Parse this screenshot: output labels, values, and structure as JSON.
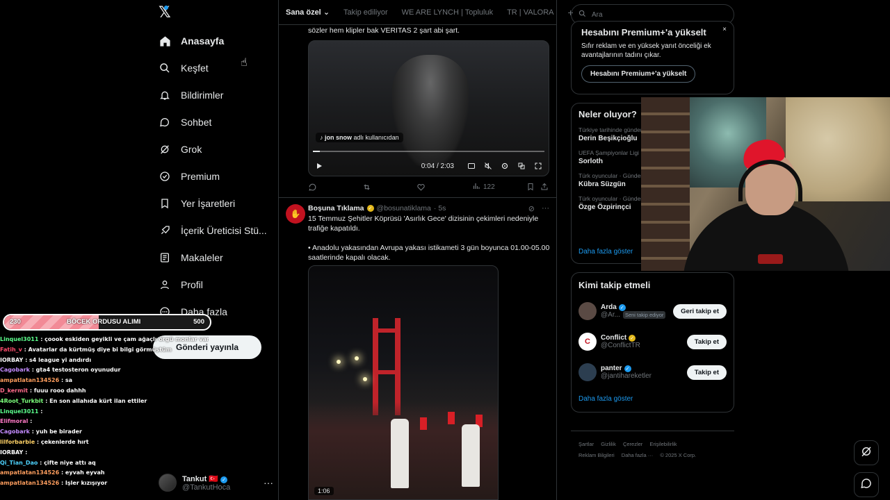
{
  "nav": {
    "items": [
      {
        "label": "Anasayfa",
        "icon": "home-icon"
      },
      {
        "label": "Keşfet",
        "icon": "search-icon"
      },
      {
        "label": "Bildirimler",
        "icon": "bell-icon"
      },
      {
        "label": "Sohbet",
        "icon": "chat-icon"
      },
      {
        "label": "Grok",
        "icon": "grok-icon"
      },
      {
        "label": "Premium",
        "icon": "premium-icon"
      },
      {
        "label": "Yer İşaretleri",
        "icon": "bookmark-icon"
      },
      {
        "label": "İçerik Üreticisi Stü...",
        "icon": "rocket-icon"
      },
      {
        "label": "Makaleler",
        "icon": "article-icon"
      },
      {
        "label": "Profil",
        "icon": "person-icon"
      },
      {
        "label": "Daha fazla",
        "icon": "more-circle-icon"
      }
    ],
    "post_button": "Gönderi yayınla",
    "profile": {
      "name": "Tankut",
      "handle": "@TankutHoca"
    }
  },
  "tabs": [
    "Sana özel",
    "Takip ediliyor",
    "WE ARE LYNCH | Topluluk",
    "TR | VALORA",
    "+"
  ],
  "post1": {
    "text_tail": "sözler hem klipler bak VERITAS 2 şart abi şart.",
    "video_tag_user": "jon snow",
    "video_tag_suffix": "adlı kullanıcıdan",
    "video_time": "0:04 / 2:03",
    "video_progress": 0.03,
    "views": "122"
  },
  "post2": {
    "author": "Boşuna Tıklama",
    "handle": "@bosunatiklama",
    "time": "· 5s",
    "text1": "15 Temmuz Şehitler Köprüsü 'Asırlık Gece' dizisinin çekimleri nedeniyle trafiğe kapatıldı.",
    "text2": "• Anadolu yakasından Avrupa yakası istikameti 3 gün boyunca 01.00-05.00 saatlerinde kapalı olacak.",
    "video_duration": "1:06"
  },
  "search": {
    "placeholder": "Ara"
  },
  "premium": {
    "title": "Hesabını Premium+'a yükselt",
    "desc": "Sıfır reklam ve en yüksek yanıt önceliği ek avantajlarının tadını çıkar.",
    "button": "Hesabını Premium+'a yükselt",
    "close": "×"
  },
  "trends": {
    "title": "Neler oluyor?",
    "items": [
      {
        "context": "Türkiye tarihinde gündem",
        "name": "Derin Beşikçioğlu"
      },
      {
        "context": "UEFA Şampiyonlar Ligi",
        "name": "Sorloth"
      },
      {
        "context": "Türk oyuncular · Gündemde",
        "name": "Kübra Süzgün"
      },
      {
        "context": "Türk oyuncular · Gündemde",
        "name": "Özge Özpirinçci"
      }
    ],
    "more": "Daha fazla göster"
  },
  "who_to_follow": {
    "title": "Kimi takip etmeli",
    "items": [
      {
        "name": "Arda",
        "handle": "@Ar...",
        "badge": "Seni takip ediyor",
        "button": "Geri takip et",
        "verified_color": "#1d9bf0"
      },
      {
        "name": "Conflict",
        "handle": "@ConflictTR",
        "badge": "",
        "button": "Takip et",
        "verified_color": "#e2b719"
      },
      {
        "name": "panter",
        "handle": "@jantihareketler",
        "badge": "",
        "button": "Takip et",
        "verified_color": "#1d9bf0"
      }
    ],
    "more": "Daha fazla göster"
  },
  "footer": {
    "line1": [
      "Şartlar",
      "Gizlilik",
      "Çerezler",
      "Erişilebilirlik"
    ],
    "line2": [
      "Reklam Bilgileri",
      "Daha fazla ···",
      "© 2025 X Corp."
    ]
  },
  "goal": {
    "current": "230",
    "label": "BÖCEK ORDUSU ALIMI",
    "max": "500",
    "progress": 0.46
  },
  "chat": [
    {
      "user": "Linquel3011",
      "color": "#5cff8d",
      "text": ": çoook eskiden geyikli ve çam ağaçlı örgü monlar vardı onlar gibi"
    },
    {
      "user": "Fatih_v",
      "color": "#ff4d6d",
      "text": ": Avatarlar da kürtmüş diye bi bilgi görmüştüm"
    },
    {
      "user": "IORBAY",
      "color": "#ffffff",
      "text": ": s4 league yi andırdı"
    },
    {
      "user": "Cagobark",
      "color": "#c48cff",
      "text": ": gta4 testosteron oyunudur"
    },
    {
      "user": "ampatlatan134526",
      "color": "#ff9e5e",
      "text": ": sa"
    },
    {
      "user": "D_kermit",
      "color": "#ff6b8a",
      "text": ": fuuu rooo dahhh"
    },
    {
      "user": "4Root_Turkbit",
      "color": "#7cff7c",
      "text": ": En son allahıda kürt ilan ettiler"
    },
    {
      "user": "Linquel3011",
      "color": "#5cff8d",
      "text": ":"
    },
    {
      "user": "Elifmoral",
      "color": "#ff79c6",
      "text": ":"
    },
    {
      "user": "Cagobark",
      "color": "#c48cff",
      "text": ": yuh be birader"
    },
    {
      "user": "lilforbarbie",
      "color": "#ffd166",
      "text": ": çekenlerde hırt"
    },
    {
      "user": "IORBAY",
      "color": "#ffffff",
      "text": ":"
    },
    {
      "user": "Qi_Tian_Dao",
      "color": "#4dd2ff",
      "text": ": çifte niye attı aq"
    },
    {
      "user": "ampatlatan134526",
      "color": "#ff9e5e",
      "text": ": eyvah eyvah"
    },
    {
      "user": "ampatlatan134526",
      "color": "#ff9e5e",
      "text": ": Işler kızışıyor"
    }
  ]
}
